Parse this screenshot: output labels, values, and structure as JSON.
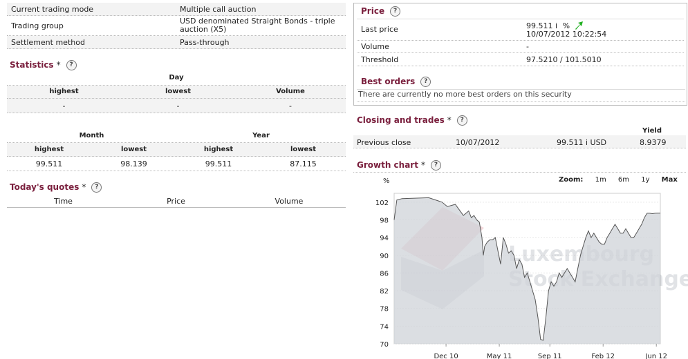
{
  "info": [
    {
      "label": "Current trading mode",
      "value": "Multiple call auction"
    },
    {
      "label": "Trading group",
      "value": "USD denominated Straight Bonds - triple auction (X5)"
    },
    {
      "label": "Settlement method",
      "value": "Pass-through"
    }
  ],
  "statistics": {
    "title": "Statistics",
    "star": "*",
    "help": "?",
    "day_header": "Day",
    "day_cols": [
      "highest",
      "lowest",
      "Volume"
    ],
    "day_vals": [
      "-",
      "-",
      "-"
    ],
    "month_header": "Month",
    "year_header": "Year",
    "my_cols": [
      "highest",
      "lowest",
      "highest",
      "lowest"
    ],
    "my_vals": [
      "99.511",
      "98.139",
      "99.511",
      "87.115"
    ]
  },
  "quotes": {
    "title": "Today's quotes",
    "star": "*",
    "help": "?",
    "cols": [
      "Time",
      "Price",
      "Volume"
    ]
  },
  "price": {
    "title": "Price",
    "help": "?",
    "last_label": "Last price",
    "last_value": "99.511",
    "last_flag": "i",
    "last_unit": "%",
    "last_time": "10/07/2012 10:22:54",
    "arrow_color": "#22b022",
    "volume_label": "Volume",
    "volume_value": "-",
    "threshold_label": "Threshold",
    "threshold_value": "97.5210 / 101.5010"
  },
  "best_orders": {
    "title": "Best orders",
    "help": "?",
    "message": "There are currently no more best orders on this security"
  },
  "closing": {
    "title": "Closing and trades",
    "star": "*",
    "help": "?",
    "yield_header": "Yield",
    "label": "Previous close",
    "date": "10/07/2012",
    "price": "99.511 i USD",
    "yield": "8.9379"
  },
  "growth": {
    "title": "Growth chart",
    "star": "*",
    "help": "?",
    "zoom_label": "Zoom:",
    "zoom_options": [
      "1m",
      "6m",
      "1y",
      "Max"
    ],
    "watermark": [
      "Luxembourg",
      "Stock Exchange"
    ]
  },
  "chart_data": {
    "type": "area",
    "ylabel": "%",
    "ylim": [
      70,
      104
    ],
    "yticks": [
      102,
      98,
      94,
      90,
      86,
      82,
      78,
      74,
      70
    ],
    "xticks": [
      "Dec 10",
      "May 11",
      "Sep 11",
      "Feb 12",
      "Jun 12"
    ],
    "x": [
      0,
      0.01,
      0.03,
      0.13,
      0.18,
      0.2,
      0.23,
      0.26,
      0.28,
      0.29,
      0.3,
      0.31,
      0.32,
      0.33,
      0.335,
      0.34,
      0.35,
      0.36,
      0.37,
      0.38,
      0.39,
      0.4,
      0.41,
      0.42,
      0.43,
      0.44,
      0.45,
      0.46,
      0.47,
      0.48,
      0.49,
      0.5,
      0.51,
      0.52,
      0.53,
      0.54,
      0.55,
      0.56,
      0.57,
      0.58,
      0.59,
      0.6,
      0.61,
      0.62,
      0.63,
      0.64,
      0.65,
      0.66,
      0.67,
      0.68,
      0.69,
      0.7,
      0.71,
      0.72,
      0.73,
      0.74,
      0.75,
      0.76,
      0.77,
      0.78,
      0.79,
      0.8,
      0.81,
      0.82,
      0.83,
      0.84,
      0.85,
      0.86,
      0.87,
      0.88,
      0.89,
      0.9,
      0.91,
      0.92,
      0.93,
      0.94,
      0.95,
      0.96,
      0.97,
      0.98,
      0.99,
      1.0
    ],
    "y": [
      98,
      102.5,
      102.8,
      103,
      102,
      101,
      101.5,
      99,
      100,
      98.5,
      99,
      98,
      97.5,
      94,
      90,
      92,
      93,
      93.5,
      93.5,
      94,
      91,
      88,
      94,
      92.5,
      90.5,
      91,
      90,
      87,
      89,
      88,
      85,
      86,
      84,
      82,
      80,
      76,
      71,
      70.8,
      76,
      82,
      84,
      83,
      84,
      86,
      85,
      86,
      87,
      86,
      85,
      84,
      87,
      90,
      92,
      94,
      95.5,
      94,
      95,
      94,
      93,
      92.5,
      92.5,
      94,
      95,
      96,
      97,
      96,
      95,
      95,
      96,
      95,
      94,
      94,
      95,
      96,
      97,
      98.5,
      99.5,
      99.5,
      99.4,
      99.5,
      99.51,
      99.511
    ]
  }
}
